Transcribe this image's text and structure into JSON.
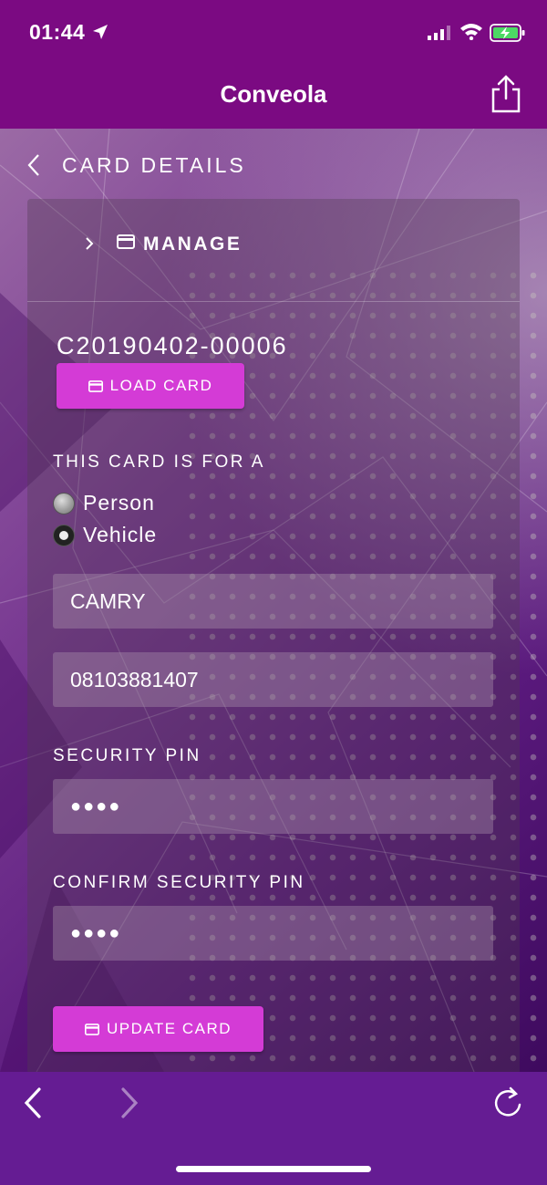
{
  "status_bar": {
    "time": "01:44"
  },
  "app": {
    "title": "Conveola"
  },
  "page": {
    "title": "CARD DETAILS",
    "manage_label": "MANAGE",
    "card_id": "C20190402-00006",
    "load_button": "LOAD CARD",
    "card_for_label": "THIS CARD IS FOR A",
    "radio_options": [
      {
        "label": "Person",
        "checked": false
      },
      {
        "label": "Vehicle",
        "checked": true
      }
    ],
    "fields": {
      "vehicle_name": "CAMRY",
      "phone": "08103881407"
    },
    "security_pin_label": "SECURITY PIN",
    "security_pin_mask": "●●●●",
    "confirm_pin_label": "CONFIRM SECURITY PIN",
    "confirm_pin_mask": "●●●●",
    "update_button": "UPDATE CARD"
  },
  "colors": {
    "topbar": "#7b0a82",
    "accent_button": "#d43bd6",
    "bottombar": "#651c93"
  },
  "icons": [
    "location-arrow-icon",
    "signal-icon",
    "wifi-icon",
    "battery-icon",
    "share-icon",
    "back-chevron-icon",
    "chevron-right-icon",
    "card-icon",
    "nav-back-icon",
    "nav-forward-icon",
    "reload-icon"
  ]
}
